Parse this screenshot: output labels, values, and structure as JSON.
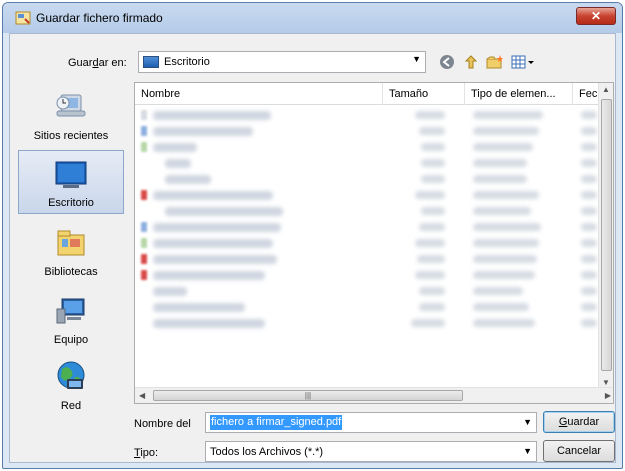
{
  "window": {
    "title": "Guardar fichero firmado",
    "close_label": "✕"
  },
  "lookin": {
    "label_pre": "Guar",
    "label_accel": "d",
    "label_post": "ar en:",
    "value": "Escritorio"
  },
  "toolbar": {
    "icons": [
      "back-icon",
      "up-folder-icon",
      "new-folder-icon",
      "view-menu-icon"
    ]
  },
  "places": [
    {
      "label": "Sitios recientes",
      "icon": "recent-places-icon"
    },
    {
      "label": "Escritorio",
      "icon": "desktop-icon",
      "selected": true
    },
    {
      "label": "Bibliotecas",
      "icon": "libraries-icon"
    },
    {
      "label": "Equipo",
      "icon": "computer-icon"
    },
    {
      "label": "Red",
      "icon": "network-icon"
    }
  ],
  "list": {
    "columns": [
      "Nombre",
      "Tamaño",
      "Tipo de elemen...",
      "Fech"
    ]
  },
  "filename": {
    "label": "Nombre del",
    "value": "fichero a firmar_signed.pdf"
  },
  "filetype": {
    "label_accel": "T",
    "label_post": "ipo:",
    "value": "Todos los Archivos (*.*)"
  },
  "buttons": {
    "save_accel": "G",
    "save_post": "uardar",
    "cancel": "Cancelar"
  },
  "colors": {
    "selection": "#3399ff",
    "title_bar": "#c9daf0",
    "close_button": "#c8432f"
  }
}
